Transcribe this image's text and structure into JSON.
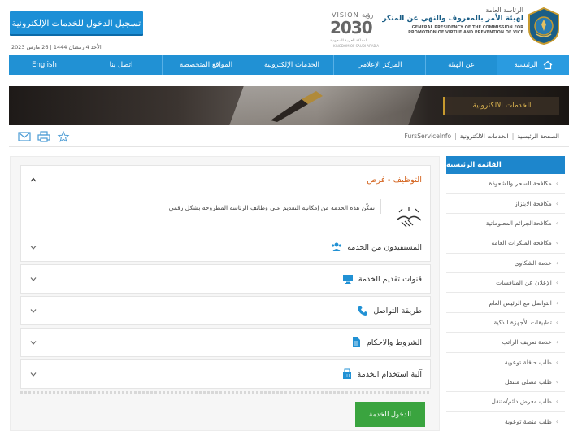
{
  "header": {
    "login_button": "تسجيل الدخول للخدمات الإلكترونية",
    "date": "الأحد 4 رمضان 1444 | 26 مارس 2023",
    "vision": {
      "top": "VISION رؤية",
      "number": "2030",
      "sub_ar": "المملكة العربية السعودية",
      "sub_en": "KINGDOM OF SAUDI ARABIA"
    },
    "org": {
      "ar_line1": "الرئاسة العامة",
      "ar_line2": "لهيئة الأمر بالمعروف والنهي عن المنكر",
      "en_line1": "GENERAL PRESIDENCY OF THE COMMISSION FOR",
      "en_line2": "PROMOTION OF VIRTUE AND PREVENTION OF VICE"
    }
  },
  "nav": {
    "items": [
      {
        "label": "الرئيسية",
        "active": true
      },
      {
        "label": "عن الهيئة"
      },
      {
        "label": "المركز الإعلامي"
      },
      {
        "label": "الخدمات الإلكترونية"
      },
      {
        "label": "المواقع المتخصصة"
      },
      {
        "label": "اتصل بنا"
      },
      {
        "label": "English"
      }
    ]
  },
  "banner": {
    "title": "الخدمات الالكترونية"
  },
  "breadcrumb": {
    "home": "الصفحة الرئيسية",
    "services": "الخدمات الالكترونية",
    "current": "FursServiceInfo"
  },
  "sidebar": {
    "title": "القائمة الرئيسية",
    "items": [
      "مكافحة السحر والشعوذة",
      "مكافحة الابتزاز",
      "مكافحةالجرائم المعلوماتية",
      "مكافحة المنكرات العامة",
      "خدمة الشكاوى",
      "الإعلان عن المنافسات",
      "التواصل مع الرئيس العام",
      "تطبيقات الأجهزة الذكية",
      "خدمة تعريف الراتب",
      "طلب حافلة توعوية",
      "طلب مصلى متنقل",
      "طلب معرض دائم/متنقل",
      "طلب منصة توعوية"
    ]
  },
  "main": {
    "open_section": {
      "title": "التوظيف - فرص",
      "description": "تمكّن هذه الخدمة من إمكانية التقديم على وظائف الرئاسة المطروحة بشكل رقمي"
    },
    "sections": [
      {
        "title": "المستفيدون من الخدمة",
        "icon": "users-icon"
      },
      {
        "title": "قنوات تقديم الخدمة",
        "icon": "monitor-icon"
      },
      {
        "title": "طريقة التواصل",
        "icon": "phone-icon"
      },
      {
        "title": "الشروط والاحكام",
        "icon": "document-icon"
      },
      {
        "title": "آلية استخدام الخدمة",
        "icon": "fax-icon"
      }
    ],
    "enter_button": "الدخول للخدمة"
  },
  "colors": {
    "primary": "#2191d4",
    "accent_orange": "#d4641f",
    "green": "#3aa43f",
    "gold": "#c79a2e"
  }
}
